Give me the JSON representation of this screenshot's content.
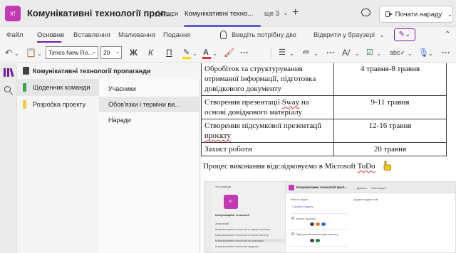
{
  "app": {
    "avatar_initials": "К!",
    "title": "Комунікативні технології проп...",
    "tabs": [
      {
        "label": "Дописи",
        "active": false
      },
      {
        "label": "Комунікативні техно...",
        "active": true
      },
      {
        "label": "ще 3",
        "active": false
      }
    ],
    "meet_label": "Почати нараду",
    "accent_color": "#5b5fc7",
    "avatar_color": "#c239b3"
  },
  "ribbon": {
    "menus": [
      {
        "label": "Файл",
        "active": false
      },
      {
        "label": "Основне",
        "active": true
      },
      {
        "label": "Вставлення",
        "active": false
      },
      {
        "label": "Малювання",
        "active": false
      },
      {
        "label": "Подання",
        "active": false
      }
    ],
    "tell_me": "Введіть потрібну дію",
    "open_in_browser": "Відкрити у браузері",
    "onenote_color": "#7719aa"
  },
  "toolbar": {
    "font_name": "Times New Ro...",
    "font_size": "20",
    "bold": "Ж",
    "italic": "К",
    "underline": "П",
    "icons": [
      "undo-icon",
      "paste-icon",
      "bold-icon",
      "italic-icon",
      "underline-icon",
      "highlight-icon",
      "font-color-icon",
      "format-painter-icon",
      "more-icon",
      "bullets-icon",
      "numbering-icon",
      "styles-icon",
      "tag-icon",
      "spelling-icon",
      "dictate-icon"
    ]
  },
  "notebook": {
    "title": "Комунікативні технології пропаганди",
    "sections": [
      {
        "label": "Щоденник команди",
        "color": "#33a94f",
        "selected": true
      },
      {
        "label": "Розробка проекту",
        "color": "#f7c948",
        "selected": false
      }
    ],
    "pages": [
      {
        "label": "Учасники",
        "selected": false
      },
      {
        "label": "Обов'язки і терміни ви...",
        "selected": true
      },
      {
        "label": "Наради",
        "selected": false
      }
    ]
  },
  "document": {
    "table": [
      {
        "task": "Обробіток та структурування отриманої інформації, підготовка довідкового документу",
        "dates": "4 травня-8 травня"
      },
      {
        "task": "Створення презентації Sway на основі довідкового матеріалу",
        "dates": "9-11 травня"
      },
      {
        "task": "Створення підсумкової презентації проєкту",
        "dates": "12-16 травня"
      },
      {
        "task": "Захист роботи",
        "dates": "20 травня"
      }
    ],
    "paragraph_prefix": "Процес виконання відслідковуємо в Microsoft ",
    "paragraph_todo": "ToDo"
  },
  "embedded_screenshot": {
    "back_label": "Усі команди",
    "team_name": "Комунікаційні технології",
    "header_title": "Комунікативні технології проп...",
    "tabs": [
      "Дописи",
      "Нові задачі"
    ],
    "list_header_1": "Список задач",
    "list_header_2": "Додати задачі нові",
    "add_task": "+ Додати задачу",
    "task_1": "Захист проєкту",
    "task_2": "Підсумкова презентація проєкту",
    "channels": [
      "Загальний",
      "Комунікативні технології в сфері політики",
      "Комунікативні технології в сфері бізнесу",
      "Комунікативні технології пропаганди",
      "Комунікативні технології ведучих"
    ]
  }
}
